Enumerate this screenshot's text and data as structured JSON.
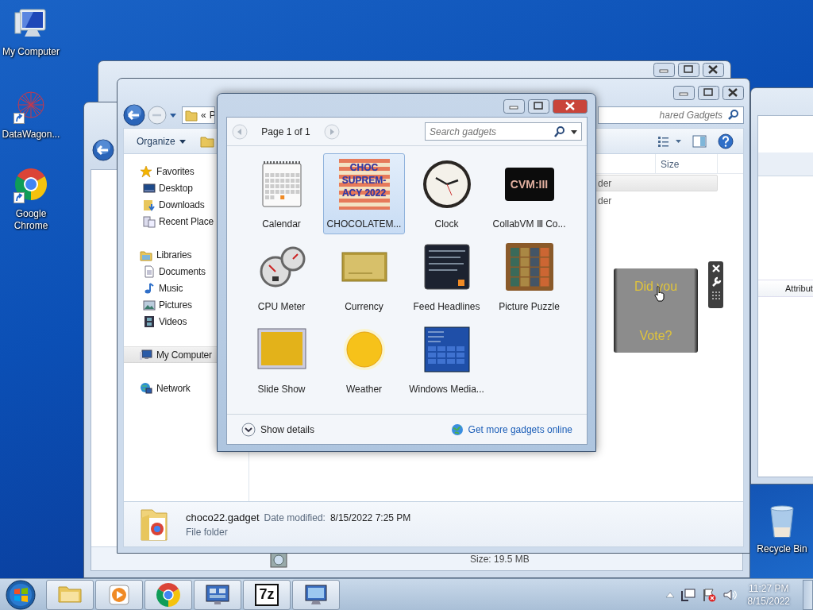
{
  "desktop_icons": [
    {
      "label": "My Computer",
      "kind": "computer",
      "shortcut": false
    },
    {
      "label": "DataWagon...",
      "kind": "network-art",
      "shortcut": true
    },
    {
      "label": "Google Chrome",
      "kind": "chrome",
      "shortcut": true
    },
    {
      "label": "Recycle Bin",
      "kind": "recycle",
      "shortcut": false
    }
  ],
  "back_window_lower": {
    "status": "Size: 19.5 MB"
  },
  "back_window_right": {
    "column_header": "Attribut"
  },
  "explorer": {
    "address_overflow": "«",
    "address_crumb": "P",
    "search_placeholder": "hared Gadgets",
    "organize": "Organize",
    "nav": [
      {
        "label": "Favorites",
        "kind": "favorites",
        "selected": false,
        "children": [
          {
            "label": "Desktop",
            "kind": "desktop",
            "selected": false
          },
          {
            "label": "Downloads",
            "kind": "downloads",
            "selected": false
          },
          {
            "label": "Recent Place",
            "kind": "recent",
            "selected": false
          }
        ]
      },
      {
        "label": "Libraries",
        "kind": "libraries",
        "selected": false,
        "children": [
          {
            "label": "Documents",
            "kind": "documents",
            "selected": false
          },
          {
            "label": "Music",
            "kind": "music",
            "selected": false
          },
          {
            "label": "Pictures",
            "kind": "pictures",
            "selected": false
          },
          {
            "label": "Videos",
            "kind": "videos",
            "selected": false
          }
        ]
      },
      {
        "label": "My Computer",
        "kind": "computer",
        "selected": true
      },
      {
        "label": "Network",
        "kind": "network",
        "selected": false
      }
    ],
    "column_header": "Size",
    "rows": [
      {
        "text": "der",
        "selected": true
      },
      {
        "text": "der",
        "selected": false
      }
    ],
    "details": {
      "name": "choco22.gadget",
      "date_label": "Date modified:",
      "date": "8/15/2022 7:25 PM",
      "type": "File folder"
    }
  },
  "gadget_gallery": {
    "page": "Page 1 of 1",
    "search_placeholder": "Search gadgets",
    "gadgets": [
      {
        "label": "Calendar",
        "kind": "calendar",
        "selected": false
      },
      {
        "label": "CHOCOLATEM...",
        "kind": "poster",
        "icon_text": "CHOC SUPREM-ACY 2022",
        "selected": true
      },
      {
        "label": "Clock",
        "kind": "clock",
        "selected": false
      },
      {
        "label": "CollabVM Ⅲ Co...",
        "kind": "logo",
        "icon_text": "CVM:III",
        "selected": false
      },
      {
        "label": "CPU Meter",
        "kind": "cpu",
        "selected": false
      },
      {
        "label": "Currency",
        "kind": "currency",
        "selected": false
      },
      {
        "label": "Feed Headlines",
        "kind": "feed",
        "selected": false
      },
      {
        "label": "Picture Puzzle",
        "kind": "puzzle",
        "selected": false
      },
      {
        "label": "Slide Show",
        "kind": "slideshow",
        "selected": false
      },
      {
        "label": "Weather",
        "kind": "weather",
        "selected": false
      },
      {
        "label": "Windows Media...",
        "kind": "media",
        "selected": false
      }
    ],
    "show_details": "Show details",
    "more_link": "Get more gadgets online"
  },
  "desktop_gadget": {
    "text_top": "Did you",
    "text_bottom": "Vote?"
  },
  "taskbar": {
    "buttons": [
      {
        "kind": "explorer"
      },
      {
        "kind": "media"
      },
      {
        "kind": "chrome"
      },
      {
        "kind": "gadgets"
      },
      {
        "kind": "archiver",
        "label": "7z"
      },
      {
        "kind": "remote"
      }
    ],
    "time": "11:27 PM",
    "date": "8/15/2022"
  }
}
